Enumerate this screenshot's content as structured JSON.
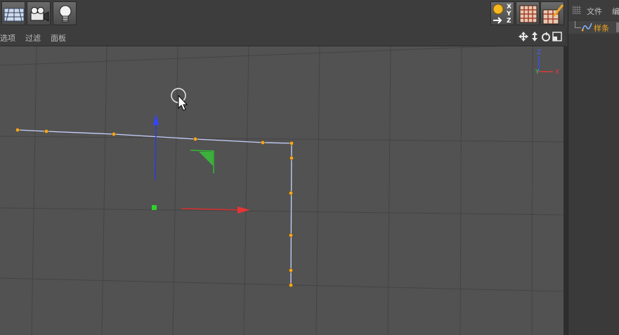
{
  "toolbar": {
    "buttons": [
      {
        "icon": "perspective-grid-icon"
      },
      {
        "icon": "camera-icon"
      },
      {
        "icon": "light-bulb-icon"
      }
    ],
    "right_buttons": [
      {
        "icon": "world-axis-xyz-icon",
        "labels": [
          "X",
          "Y",
          "Z"
        ]
      },
      {
        "icon": "texture-checker-icon"
      },
      {
        "icon": "paint-brush-icon"
      }
    ]
  },
  "viewport_menu": {
    "items": [
      {
        "label": "选项"
      },
      {
        "label": "过滤"
      },
      {
        "label": "面板"
      }
    ],
    "nav_icons": [
      "move-view-icon",
      "zoom-view-icon",
      "rotate-view-icon",
      "maximize-view-icon"
    ]
  },
  "viewport": {
    "axis_gizmo": {
      "z": "Z",
      "y": "Y",
      "x": "X"
    },
    "colors": {
      "background": "#525252",
      "grid": "#444444",
      "spline": "#c8d2ff",
      "points": "#f5a623",
      "x_axis": "#dd2d2d",
      "y_axis": "#2d3bdd",
      "z_axis": "#2dbb2d"
    }
  },
  "object_manager": {
    "menu": [
      {
        "label": "文件"
      },
      {
        "label": "编"
      }
    ],
    "object": {
      "label": "样条",
      "icon": "spline-icon"
    }
  }
}
